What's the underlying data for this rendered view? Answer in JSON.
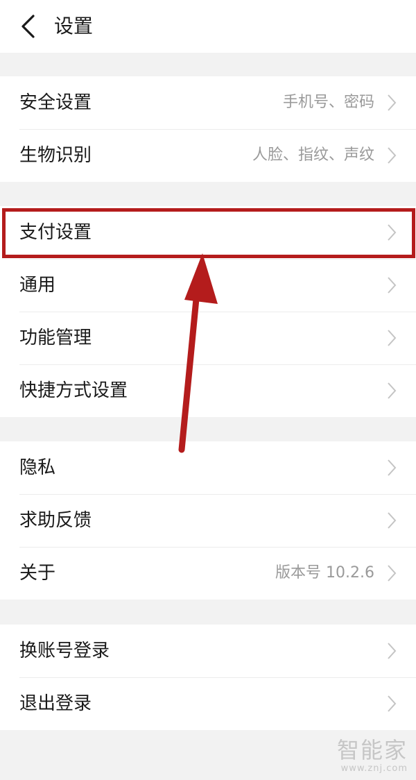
{
  "header": {
    "title": "设置",
    "back_icon": "chevron-left-icon"
  },
  "groups": [
    {
      "items": [
        {
          "label": "安全设置",
          "value": "手机号、密码"
        },
        {
          "label": "生物识别",
          "value": "人脸、指纹、声纹"
        }
      ]
    },
    {
      "items": [
        {
          "label": "支付设置",
          "value": ""
        },
        {
          "label": "通用",
          "value": ""
        },
        {
          "label": "功能管理",
          "value": ""
        },
        {
          "label": "快捷方式设置",
          "value": ""
        }
      ]
    },
    {
      "items": [
        {
          "label": "隐私",
          "value": ""
        },
        {
          "label": "求助反馈",
          "value": ""
        },
        {
          "label": "关于",
          "value": "版本号 10.2.6"
        }
      ]
    },
    {
      "items": [
        {
          "label": "换账号登录",
          "value": ""
        },
        {
          "label": "退出登录",
          "value": ""
        }
      ]
    }
  ],
  "annotation": {
    "highlight_color": "#b41c1c",
    "highlighted_item": "支付设置"
  },
  "watermark": {
    "logo": "智能家",
    "url": "www.znj.com"
  },
  "colors": {
    "background": "#f2f2f2",
    "card": "#ffffff",
    "text_primary": "#1a1a1a",
    "text_secondary": "#9a9a9a",
    "chevron": "#c4c4c4"
  }
}
